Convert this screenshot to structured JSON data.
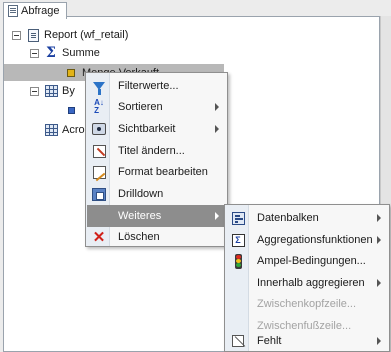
{
  "panel": {
    "tab_label": "Abfrage"
  },
  "tree": {
    "root_label": "Report (wf_retail)",
    "summe_label": "Summe",
    "measure_label": "Menge Verkauft",
    "by_label": "By",
    "across_label": "Acro"
  },
  "context_menu": {
    "items": [
      {
        "label": "Filterwerte...",
        "icon": "filter-icon"
      },
      {
        "label": "Sortieren",
        "icon": "sort-icon",
        "submenu": true
      },
      {
        "label": "Sichtbarkeit",
        "icon": "visibility-icon",
        "submenu": true
      },
      {
        "label": "Titel ändern...",
        "icon": "edit-title-icon"
      },
      {
        "label": "Format bearbeiten",
        "icon": "format-icon"
      },
      {
        "label": "Drilldown",
        "icon": "drilldown-icon"
      },
      {
        "label": "Weiteres",
        "icon": "",
        "submenu": true,
        "highlighted": true
      },
      {
        "label": "Löschen",
        "icon": "delete-icon"
      }
    ]
  },
  "submenu": {
    "items": [
      {
        "label": "Datenbalken",
        "icon": "databar-icon",
        "submenu": true
      },
      {
        "label": "Aggregationsfunktionen",
        "icon": "aggregation-icon",
        "submenu": true
      },
      {
        "label": "Ampel-Bedingungen...",
        "icon": "traffic-light-icon"
      },
      {
        "label": "Innerhalb aggregieren",
        "icon": "",
        "submenu": true
      },
      {
        "label": "Zwischenkopfzeile...",
        "icon": "",
        "disabled": true
      },
      {
        "label": "Zwischenfußzeile...",
        "icon": "",
        "disabled": true
      },
      {
        "label": "Fehlt",
        "icon": "missing-icon",
        "submenu": true
      }
    ]
  },
  "colors": {
    "highlight": "#8d8d8d",
    "selected_row": "#b8b8b8",
    "accent_blue": "#2b73c7"
  }
}
